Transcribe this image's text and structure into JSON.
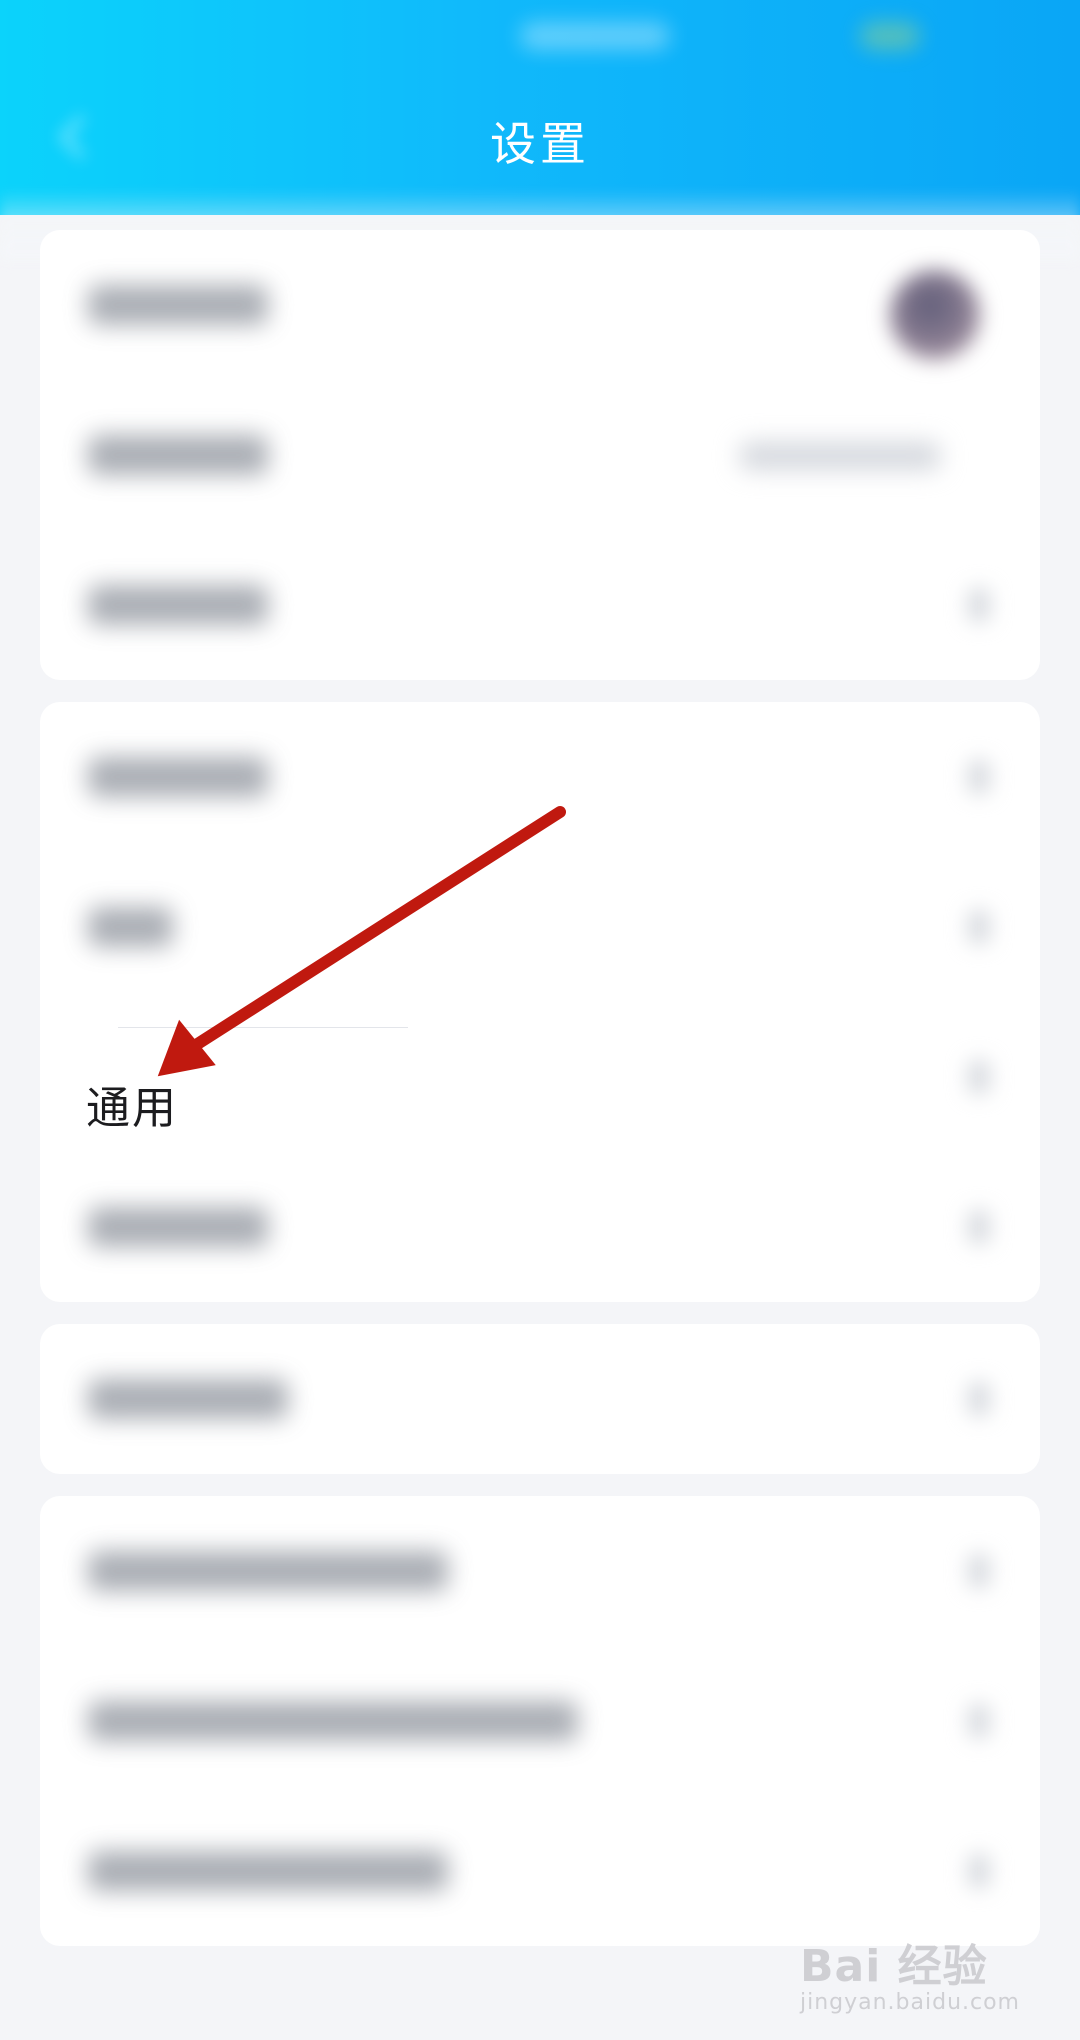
{
  "header": {
    "title": "设置"
  },
  "settings": {
    "general_label": "通用"
  },
  "watermark": {
    "brand": "Bai 经验",
    "url": "jingyan.baidu.com"
  },
  "colors": {
    "header_gradient_start": "#0bd3fb",
    "header_gradient_end": "#0aa6f6",
    "annotation_arrow": "#c0190f"
  },
  "icons": {
    "back": "back-arrow-icon",
    "avatar": "avatar",
    "row_chevron": "chevron-right-icon",
    "annotation": "red-arrow-icon"
  }
}
